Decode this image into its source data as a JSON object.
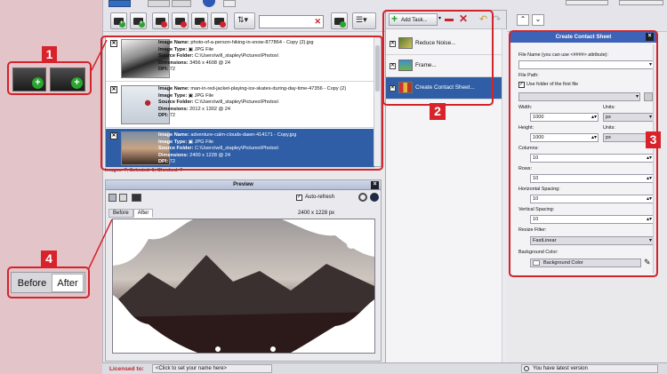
{
  "toolbar": {
    "search_placeholder": "",
    "clear_symbol": "✕",
    "icons": [
      "add-images-icon",
      "add-folder-icon",
      "remove-image-icon",
      "remove-folder-icon",
      "remove-all-icon",
      "sort-icon",
      "filter-icon",
      "list-view-icon"
    ]
  },
  "images": {
    "items": [
      {
        "checked": "✕",
        "name_label": "Image Name:",
        "name": "photo-of-a-person-hiking-in-snow-877864 - Copy (2).jpg",
        "type_label": "Image Type:",
        "type": "JPG File",
        "folder_label": "Source Folder:",
        "folder": "C:\\Users\\will_stapley\\Pictures\\Photos\\",
        "dim_label": "Dimensions:",
        "dimensions": "3456 x 4608 @ 24",
        "dpi_label": "DPI:",
        "dpi": "72"
      },
      {
        "checked": "✕",
        "name_label": "Image Name:",
        "name": "man-in-red-jacket-playing-ice-skates-during-day-time-47356 - Copy (2)",
        "type_label": "Image Type:",
        "type": "JPG File",
        "folder_label": "Source Folder:",
        "folder": "C:\\Users\\will_stapley\\Pictures\\Photos\\",
        "dim_label": "Dimensions:",
        "dimensions": "2012 x 1302 @ 24",
        "dpi_label": "DPI:",
        "dpi": "72"
      },
      {
        "checked": "✕",
        "name_label": "Image Name:",
        "name": "adventure-calm-clouds-dawn-414171 - Copy.jpg",
        "type_label": "Image Type:",
        "type": "JPG File",
        "folder_label": "Source Folder:",
        "folder": "C:\\Users\\will_stapley\\Pictures\\Photos\\",
        "dim_label": "Dimensions:",
        "dimensions": "2400 x 1228 @ 24",
        "dpi_label": "DPI:",
        "dpi": "72"
      }
    ],
    "status": "Images: 7; Selected: 1; Checked: 7"
  },
  "preview": {
    "title": "Preview",
    "auto_refresh": "Auto-refresh",
    "tab_before": "Before",
    "tab_after": "After",
    "size": "2400 x 1228 px"
  },
  "tasks": {
    "add_label": "Add Task...",
    "items": [
      {
        "label": "Reduce Noise...",
        "checked": "✕"
      },
      {
        "label": "Frame...",
        "checked": "✕"
      },
      {
        "label": "Create Contact Sheet...",
        "checked": "✕"
      }
    ]
  },
  "properties": {
    "title": "Create Contact Sheet",
    "file_name_label": "File Name (you can use <####> attribute):",
    "file_path_label": "File Path:",
    "use_folder_label": "Use folder of the first file",
    "width_label": "Width:",
    "width": "1000",
    "units_label": "Units:",
    "units": "px",
    "height_label": "Height:",
    "height": "1000",
    "height_units_label": "Units:",
    "height_units": "px",
    "columns_label": "Columns:",
    "columns": "10",
    "rows_label": "Rows:",
    "rows": "10",
    "hspacing_label": "Horizontal Spacing:",
    "hspacing": "10",
    "vspacing_label": "Vertical Spacing:",
    "vspacing": "10",
    "resize_filter_label": "Resize Filter:",
    "resize_filter": "FastLinear",
    "bg_color_label": "Background Color:",
    "bg_color": "Background Color"
  },
  "callouts": {
    "n1": "1",
    "n2": "2",
    "n3": "3",
    "n4": "4",
    "before": "Before",
    "after": "After"
  },
  "footer": {
    "licensed_label": "Licensed to:",
    "licensed_value": "<Click to set your name here>",
    "version": "You have latest version"
  },
  "colors": {
    "accent": "#2f5ea6",
    "callout_red": "#d8232b",
    "header_blue": "#3d63b8"
  }
}
